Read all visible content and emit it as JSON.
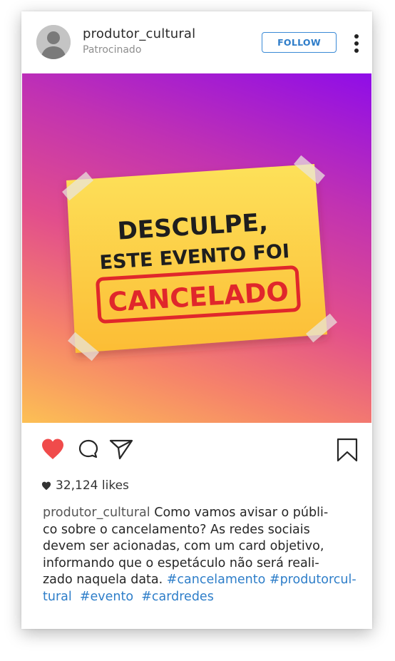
{
  "post": {
    "username": "produtor_cultural",
    "sponsored_label": "Patrocinado",
    "follow_label": "FOLLOW",
    "image": {
      "line1": "DESCULPE,",
      "line2": "ESTE EVENTO FOI",
      "stamp": "CANCELADO",
      "colors": {
        "gradient_top": "#8f0de8",
        "gradient_bottom": "#fcc054",
        "note": "#fdd24a",
        "stamp": "#e0272b"
      }
    },
    "likes_count": "32,124 likes",
    "caption": {
      "author": "produtor_cultural",
      "line1_rest": " Como vamos avisar o públi-",
      "line2": "co sobre o cancelamento? As redes sociais",
      "line3": "devem ser acionadas, com um card objetivo,",
      "line4": "informando que o espetáculo não será reali-",
      "line5_text": "zado naquela data. ",
      "hashtag1": "#cancelamento",
      "hashtag2_part1": "#produtorcul-",
      "hashtag2_part2": "tural",
      "hashtag3": "#evento",
      "hashtag4": "#cardredes"
    },
    "colors": {
      "heart": "#f04b4b",
      "link": "#2e7ec9",
      "follow_border": "#3a8ad6"
    },
    "icons": [
      "avatar-placeholder-icon",
      "more-options-icon",
      "heart-icon",
      "comment-icon",
      "share-icon",
      "bookmark-icon",
      "small-heart-icon"
    ]
  }
}
